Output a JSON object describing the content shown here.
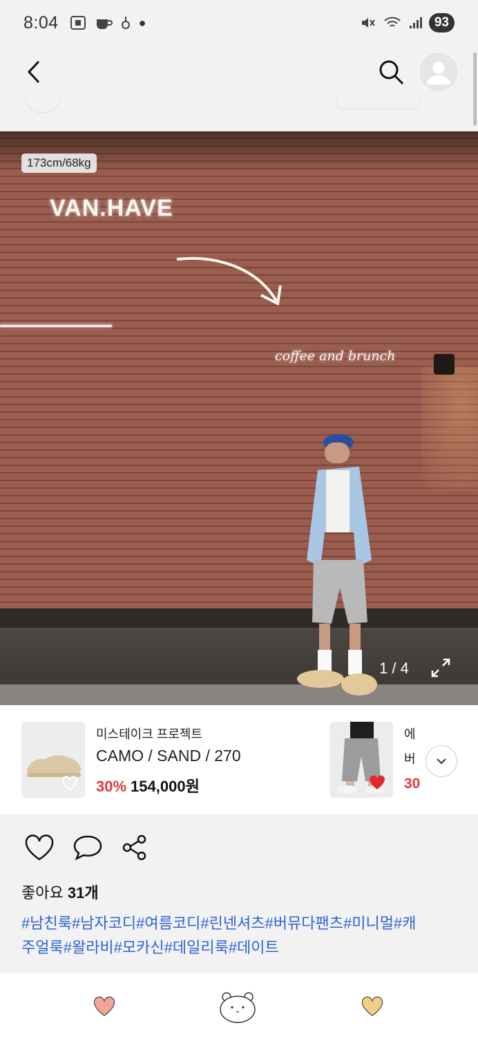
{
  "status_bar": {
    "time": "8:04",
    "battery": "93"
  },
  "photo": {
    "size_tag": "173cm/68kg",
    "sign_logo": "VAN.HAVE",
    "sign_script": "coffee and brunch",
    "counter": "1 / 4"
  },
  "products": [
    {
      "brand": "미스테이크 프로젝트",
      "option": "CAMO / SAND / 270",
      "discount": "30%",
      "price": "154,000원",
      "wishlisted": false
    },
    {
      "brand_peek": "에",
      "option_peek": "버",
      "discount_peek": "30",
      "wishlisted": true
    }
  ],
  "post": {
    "likes_label": "좋아요",
    "likes_count": "31개",
    "hashtags_line1": "#남친룩#남자코디#여름코디#린넨셔츠#버뮤다팬츠#미니멀#캐",
    "hashtags_line2": "주얼룩#왈라비#모카신#데일리룩#데이트"
  },
  "colors": {
    "accent_red": "#e03a3a",
    "hashtag_blue": "#2f62d6",
    "heart_pink": "#f2a49a",
    "heart_gold": "#f2cf82"
  },
  "icons": [
    "back-arrow-icon",
    "search-icon",
    "profile-avatar-icon",
    "expand-icon",
    "heart-icon",
    "comment-icon",
    "share-icon",
    "chevron-down-icon",
    "bear-icon"
  ]
}
